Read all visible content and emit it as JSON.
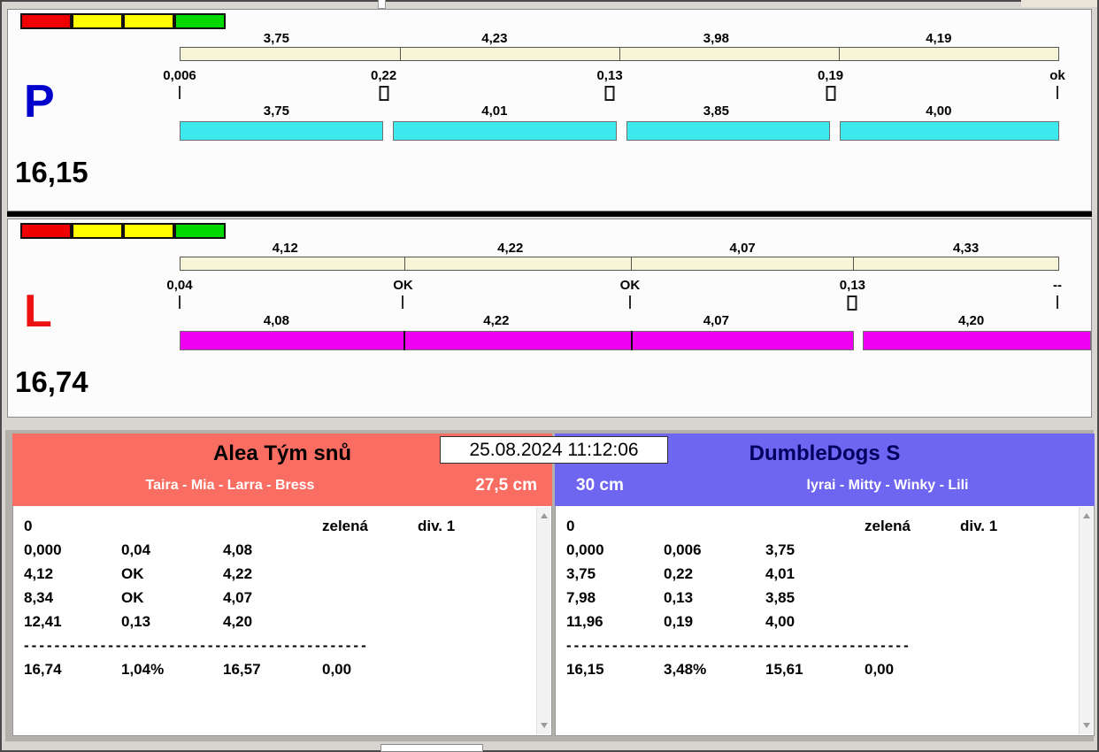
{
  "colors": {
    "light_red": "#ef0000",
    "light_yellow": "#ffff00",
    "light_green": "#00d800",
    "track_cream": "#f7f5d8",
    "lane_p_bar": "#3de9ed",
    "lane_l_bar": "#f000f0",
    "letter_p": "#0000cc",
    "letter_l": "#ee1111",
    "team_left_header": "#fa6d62",
    "team_right_header": "#6e66f0"
  },
  "timestamp": "25.08.2024 11:12:06",
  "lanes": [
    {
      "letter": "P",
      "total": "16,15",
      "top_values": [
        "3,75",
        "4,23",
        "3,98",
        "4,19"
      ],
      "mid_values": [
        "0,006",
        "0,22",
        "0,13",
        "0,19",
        "ok"
      ],
      "bottom_values": [
        "3,75",
        "4,01",
        "3,85",
        "4,00"
      ]
    },
    {
      "letter": "L",
      "total": "16,74",
      "top_values": [
        "4,12",
        "4,22",
        "4,07",
        "4,33"
      ],
      "mid_values": [
        "0,04",
        "OK",
        "OK",
        "0,13",
        "--"
      ],
      "bottom_values": [
        "4,08",
        "4,22",
        "4,07",
        "4,20"
      ]
    }
  ],
  "teams": [
    {
      "name": "Alea Tým snů",
      "dogs": "Taira - Mia - Larra - Bress",
      "jump_height": "27,5 cm",
      "rows": [
        [
          "0",
          "",
          "",
          "zelená",
          "div. 1"
        ],
        [
          "0,000",
          "0,04",
          "4,08",
          "",
          ""
        ],
        [
          "4,12",
          "OK",
          "4,22",
          "",
          ""
        ],
        [
          "8,34",
          "OK",
          "4,07",
          "",
          ""
        ],
        [
          "12,41",
          "0,13",
          "4,20",
          "",
          ""
        ],
        [
          "16,74",
          "1,04%",
          "16,57",
          "0,00",
          ""
        ]
      ],
      "separator": "---------------------------------------------"
    },
    {
      "name": "DumbleDogs S",
      "dogs": "lyrai - Mitty - Winky - Lili",
      "jump_height": "30 cm",
      "rows": [
        [
          "0",
          "",
          "",
          "zelená",
          "div. 1"
        ],
        [
          "0,000",
          "0,006",
          "3,75",
          "",
          ""
        ],
        [
          "3,75",
          "0,22",
          "4,01",
          "",
          ""
        ],
        [
          "7,98",
          "0,13",
          "3,85",
          "",
          ""
        ],
        [
          "11,96",
          "0,19",
          "4,00",
          "",
          ""
        ],
        [
          "16,15",
          "3,48%",
          "15,61",
          "0,00",
          ""
        ]
      ],
      "separator": "---------------------------------------------"
    }
  ]
}
